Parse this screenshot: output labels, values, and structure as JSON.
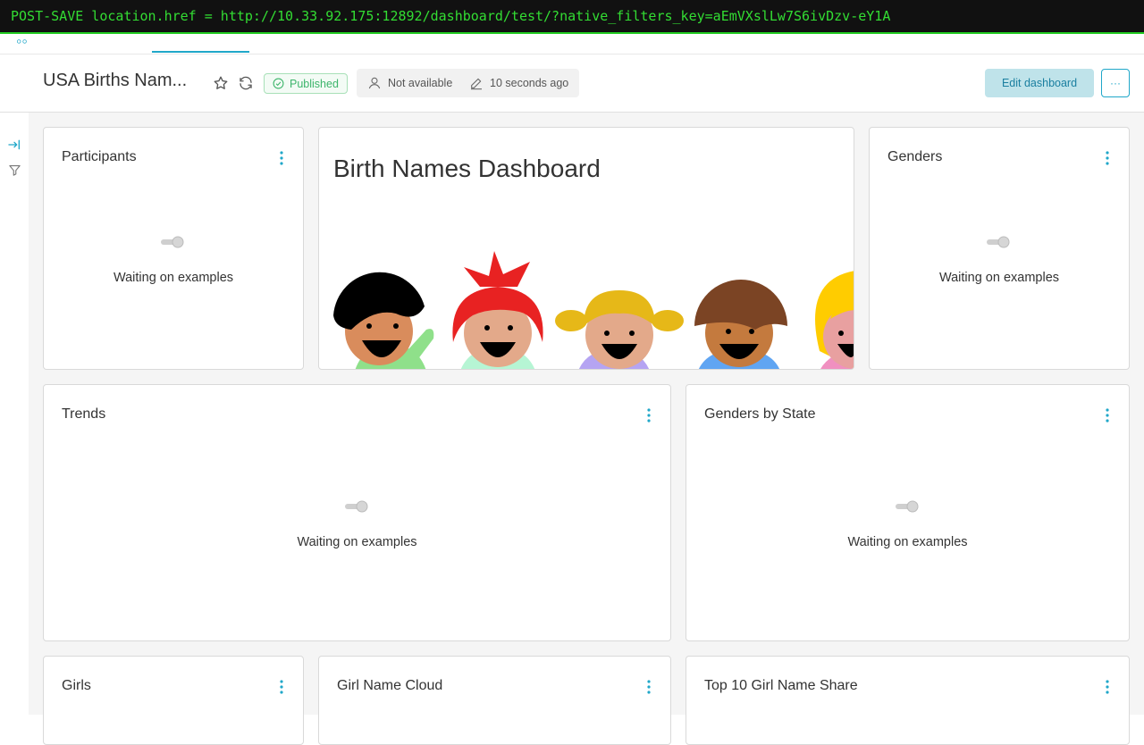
{
  "debug": {
    "text": "POST-SAVE location.href = http://10.33.92.175:12892/dashboard/test/?native_filters_key=aEmVXslLw7S6ivDzv-eY1A"
  },
  "header": {
    "title": "USA Births Nam...",
    "status": "Published",
    "owner": "Not available",
    "modified": "10 seconds ago",
    "edit_label": "Edit dashboard",
    "more_label": "···"
  },
  "cards": {
    "participants": {
      "title": "Participants",
      "status": "Waiting on examples"
    },
    "markdown": {
      "heading": "Birth Names Dashboard"
    },
    "genders": {
      "title": "Genders",
      "status": "Waiting on examples"
    },
    "trends": {
      "title": "Trends",
      "status": "Waiting on examples"
    },
    "genders_by_state": {
      "title": "Genders by State",
      "status": "Waiting on examples"
    },
    "girls": {
      "title": "Girls"
    },
    "girl_name_cloud": {
      "title": "Girl Name Cloud"
    },
    "top10_girl": {
      "title": "Top 10 Girl Name Share"
    }
  },
  "colors": {
    "accent": "#20a7c9",
    "published": "#3db56b",
    "edit_bg": "#bfe3ea"
  },
  "icons": [
    "expand-panel-icon",
    "filter-icon",
    "star-icon",
    "refresh-icon",
    "check-circle-icon",
    "user-icon",
    "pencil-icon",
    "vertical-dots-icon",
    "loading-icon"
  ]
}
